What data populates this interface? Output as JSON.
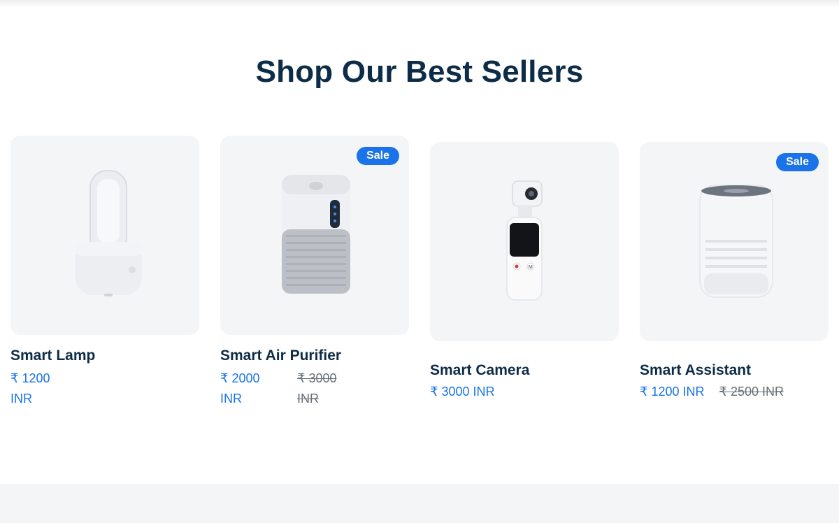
{
  "section": {
    "title": "Shop Our Best Sellers"
  },
  "products": [
    {
      "name": "Smart Lamp",
      "price_num": "₹ 1200",
      "price_unit": "INR"
    },
    {
      "name": "Smart Air Purifier",
      "badge": "Sale",
      "price_num": "₹ 2000",
      "price_unit": "INR",
      "old_num": "₹ 3000",
      "old_unit": "INR"
    },
    {
      "name": "Smart Camera",
      "price": "₹ 3000 INR"
    },
    {
      "name": "Smart Assistant",
      "badge": "Sale",
      "price": "₹ 1200 INR",
      "old_price": "₹ 2500 INR"
    }
  ],
  "colors": {
    "title": "#0d2c47",
    "price": "#1a73e8",
    "badge": "#1a73e8",
    "card_bg": "#f4f5f7",
    "old_price": "#666e76"
  }
}
